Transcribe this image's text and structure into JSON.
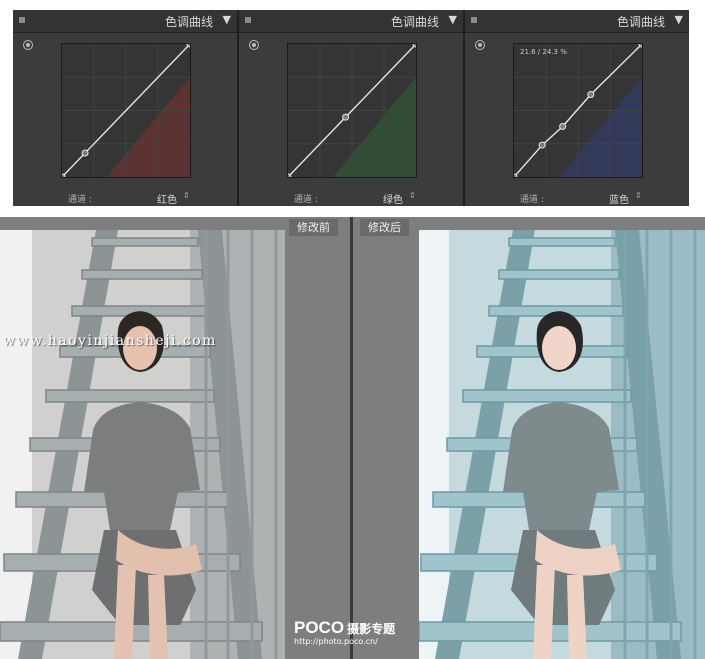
{
  "panels": [
    {
      "title": "色调曲线",
      "collapse_icon": "▼",
      "channel_label": "通道 :",
      "channel_value": "红色",
      "arrows": "⇕",
      "readout": "",
      "accent": "#8a3030",
      "points": [
        [
          0,
          0
        ],
        [
          0.18,
          0.18
        ],
        [
          1,
          1
        ]
      ]
    },
    {
      "title": "色调曲线",
      "collapse_icon": "▼",
      "channel_label": "通道 :",
      "channel_value": "绿色",
      "arrows": "⇕",
      "readout": "",
      "accent": "#2f6a35",
      "points": [
        [
          0,
          0
        ],
        [
          0.45,
          0.45
        ],
        [
          1,
          1
        ]
      ]
    },
    {
      "title": "色调曲线",
      "collapse_icon": "▼",
      "channel_label": "通道 :",
      "channel_value": "蓝色",
      "arrows": "⇕",
      "readout": "21.6 / 24.3 %",
      "accent": "#2e3f86",
      "points": [
        [
          0,
          0
        ],
        [
          0.22,
          0.24
        ],
        [
          0.38,
          0.38
        ],
        [
          0.6,
          0.62
        ],
        [
          1,
          1
        ]
      ]
    }
  ],
  "compare": {
    "before_label": "修改前",
    "after_label": "修改后",
    "watermark": "www.haoyinjiansheji.com",
    "logo_main": "POCO",
    "logo_sub": "摄影专题",
    "logo_url": "http://photo.poco.cn/"
  }
}
